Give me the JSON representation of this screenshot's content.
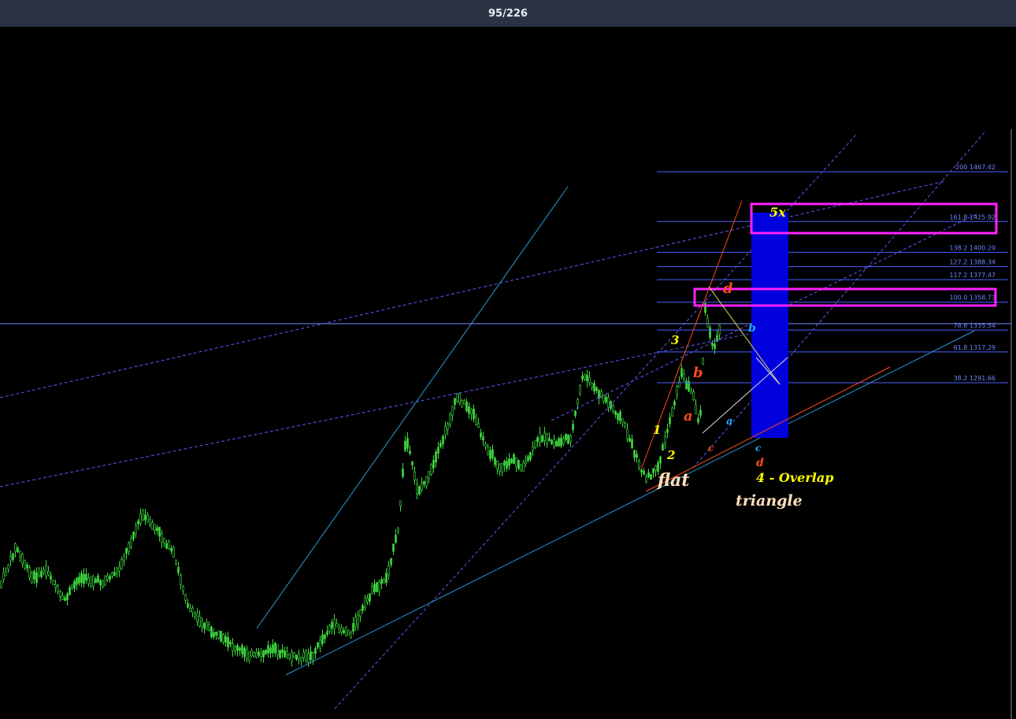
{
  "header": {
    "page_counter": "95/226"
  },
  "colors": {
    "background": "#000000",
    "header_bg": "#2a3344",
    "candle": "#3fdc3f",
    "fib_level": "#4a5fff",
    "fib_text": "#6f87ff",
    "trendline": "#2e9bd8",
    "channel_dashed": "#5a5aff",
    "highlight_box": "#ff22ff",
    "target_zone": "#0000dd",
    "wave_yellow": "#ffff00",
    "wave_red": "#ff4a1a",
    "wave_cyan": "#22aaff",
    "pattern_text": "#ffe0bc"
  },
  "chart_data": {
    "type": "candlestick",
    "title": "",
    "xlabel": "",
    "ylabel": "",
    "price_range": [
      1180,
      1500
    ],
    "fib_levels": [
      {
        "label": "200 1467.42",
        "ratio": 200,
        "price": 1467.42
      },
      {
        "label": "161.8 1425.92",
        "ratio": 161.8,
        "price": 1425.92
      },
      {
        "label": "138.2 1400.29",
        "ratio": 138.2,
        "price": 1400.29
      },
      {
        "label": "127.2 1388.34",
        "ratio": 127.2,
        "price": 1388.34
      },
      {
        "label": "117.2 1377.47",
        "ratio": 117.2,
        "price": 1377.47
      },
      {
        "label": "100.0   1358.73",
        "ratio": 100.0,
        "price": 1358.73
      },
      {
        "label": "78.6 1335.54",
        "ratio": 78.6,
        "price": 1335.54
      },
      {
        "label": "61.8 1317.29",
        "ratio": 61.8,
        "price": 1317.29
      },
      {
        "label": "38.2 1291.66",
        "ratio": 38.2,
        "price": 1291.66
      }
    ],
    "wave_labels": [
      {
        "text": "1",
        "color": "yellow"
      },
      {
        "text": "2",
        "color": "yellow"
      },
      {
        "text": "3",
        "color": "yellow"
      },
      {
        "text": "a",
        "color": "red"
      },
      {
        "text": "b",
        "color": "red"
      },
      {
        "text": "c",
        "color": "red"
      },
      {
        "text": "d",
        "color": "red"
      },
      {
        "text": "d",
        "color": "red"
      },
      {
        "text": "a",
        "color": "cyan"
      },
      {
        "text": "b",
        "color": "cyan"
      },
      {
        "text": "c",
        "color": "cyan"
      },
      {
        "text": "5x",
        "color": "yellow"
      }
    ],
    "annotations": [
      "flat",
      "triangle",
      "4 - Overlap"
    ]
  }
}
